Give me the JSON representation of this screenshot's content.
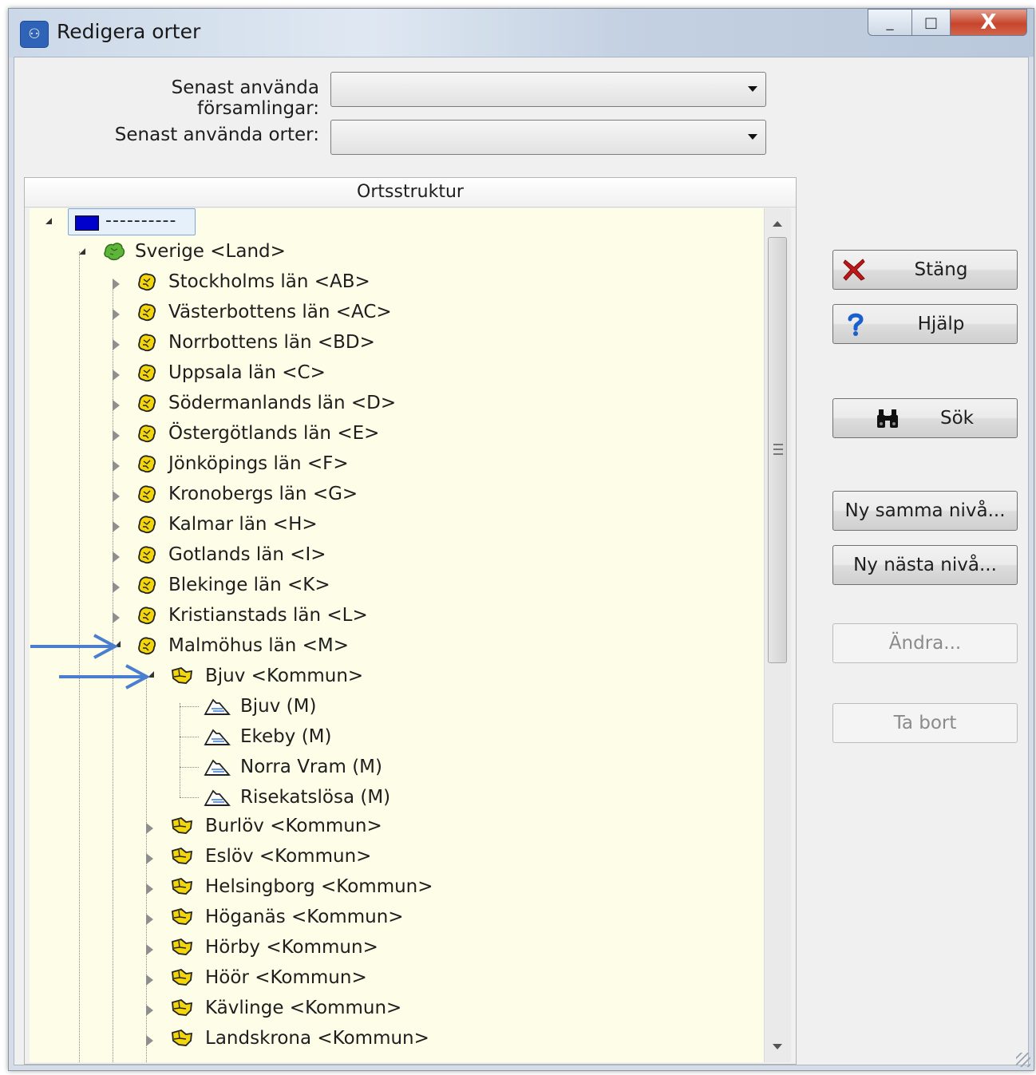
{
  "window": {
    "title": "Redigera orter",
    "close_glyph": "X",
    "maximize_glyph": "□",
    "minimize_glyph": "_"
  },
  "combos": {
    "forsamlingar_label": "Senast använda församlingar:",
    "forsamlingar_value": "",
    "orter_label": "Senast använda orter:",
    "orter_value": ""
  },
  "tree": {
    "header": "Ortsstruktur",
    "root_label": "----------",
    "country": "Sverige <Land>",
    "lan": [
      "Stockholms län <AB>",
      "Västerbottens län <AC>",
      "Norrbottens län <BD>",
      "Uppsala län <C>",
      "Södermanlands län <D>",
      "Östergötlands län <E>",
      "Jönköpings län <F>",
      "Kronobergs län <G>",
      "Kalmar län <H>",
      "Gotlands län <I>",
      "Blekinge län <K>",
      "Kristianstads län <L>",
      "Malmöhus län <M>"
    ],
    "expanded_kommun": "Bjuv <Kommun>",
    "orter": [
      "Bjuv (M)",
      "Ekeby (M)",
      "Norra Vram (M)",
      "Risekatslösa (M)"
    ],
    "kommuner": [
      "Burlöv <Kommun>",
      "Eslöv <Kommun>",
      "Helsingborg <Kommun>",
      "Höganäs <Kommun>",
      "Hörby <Kommun>",
      "Höör <Kommun>",
      "Kävlinge <Kommun>",
      "Landskrona <Kommun>"
    ]
  },
  "buttons": {
    "stang": "Stäng",
    "hjalp": "Hjälp",
    "sok": "Sök",
    "ny_samma": "Ny samma nivå...",
    "ny_nasta": "Ny nästa nivå...",
    "andra": "Ändra...",
    "ta_bort": "Ta bort"
  },
  "colors": {
    "tree_background": "#fdfde8",
    "annotation_arrow": "#4a7fd0",
    "stang_icon": "#c0181a",
    "hjalp_icon": "#1a5fcf"
  }
}
